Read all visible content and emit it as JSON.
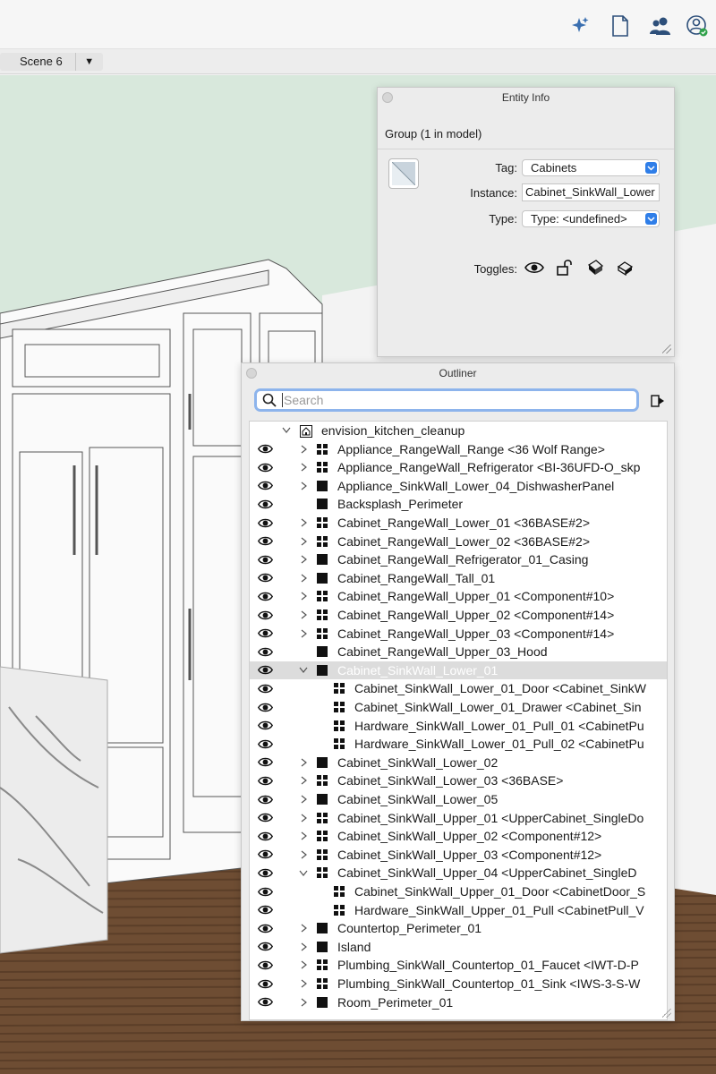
{
  "toolbar": {
    "icons": [
      "sparkle-icon",
      "document-icon",
      "users-icon",
      "account-icon"
    ]
  },
  "scenes": {
    "tabs": [
      "Scene 6"
    ],
    "menu_glyph": "▼"
  },
  "colors": {
    "accent": "#2f7ee8",
    "sparkle": "#3a6fb0",
    "viewport_wall": "#d8e8dc",
    "viewport_floor": "#6e4d33"
  },
  "entity_info": {
    "title": "Entity Info",
    "selection": "Group (1 in model)",
    "tag_label": "Tag:",
    "tag_value": "Cabinets",
    "instance_label": "Instance:",
    "instance_value": "Cabinet_SinkWall_Lower",
    "type_label": "Type:",
    "type_value": "Type: <undefined>",
    "toggles_label": "Toggles:",
    "toggle_icons": [
      "eye-icon",
      "unlock-icon",
      "cast-shadows-icon",
      "receive-shadows-icon"
    ]
  },
  "outliner": {
    "title": "Outliner",
    "search_placeholder": "Search",
    "root": "envision_kitchen_cleanup",
    "rows": [
      {
        "label": "Appliance_RangeWall_Range <36 Wolf Range>",
        "kind": "comp",
        "depth": 0,
        "expand": "collapsed"
      },
      {
        "label": "Appliance_RangeWall_Refrigerator <BI-36UFD-O_skp",
        "kind": "comp",
        "depth": 0,
        "expand": "collapsed"
      },
      {
        "label": "Appliance_SinkWall_Lower_04_DishwasherPanel",
        "kind": "group",
        "depth": 0,
        "expand": "collapsed"
      },
      {
        "label": "Backsplash_Perimeter",
        "kind": "group",
        "depth": 0,
        "expand": "none"
      },
      {
        "label": "Cabinet_RangeWall_Lower_01 <36BASE#2>",
        "kind": "comp",
        "depth": 0,
        "expand": "collapsed"
      },
      {
        "label": "Cabinet_RangeWall_Lower_02 <36BASE#2>",
        "kind": "comp",
        "depth": 0,
        "expand": "collapsed"
      },
      {
        "label": "Cabinet_RangeWall_Refrigerator_01_Casing",
        "kind": "group",
        "depth": 0,
        "expand": "collapsed"
      },
      {
        "label": "Cabinet_RangeWall_Tall_01",
        "kind": "group",
        "depth": 0,
        "expand": "collapsed"
      },
      {
        "label": "Cabinet_RangeWall_Upper_01 <Component#10>",
        "kind": "comp",
        "depth": 0,
        "expand": "collapsed"
      },
      {
        "label": "Cabinet_RangeWall_Upper_02 <Component#14>",
        "kind": "comp",
        "depth": 0,
        "expand": "collapsed"
      },
      {
        "label": "Cabinet_RangeWall_Upper_03 <Component#14>",
        "kind": "comp",
        "depth": 0,
        "expand": "collapsed"
      },
      {
        "label": "Cabinet_RangeWall_Upper_03_Hood",
        "kind": "group",
        "depth": 0,
        "expand": "none"
      },
      {
        "label": "Cabinet_SinkWall_Lower_01",
        "kind": "group",
        "depth": 0,
        "expand": "expanded",
        "selected": true
      },
      {
        "label": "Cabinet_SinkWall_Lower_01_Door <Cabinet_SinkW",
        "kind": "comp",
        "depth": 1,
        "expand": "none"
      },
      {
        "label": "Cabinet_SinkWall_Lower_01_Drawer <Cabinet_Sin",
        "kind": "comp",
        "depth": 1,
        "expand": "none"
      },
      {
        "label": "Hardware_SinkWall_Lower_01_Pull_01 <CabinetPu",
        "kind": "comp",
        "depth": 1,
        "expand": "none"
      },
      {
        "label": "Hardware_SinkWall_Lower_01_Pull_02 <CabinetPu",
        "kind": "comp",
        "depth": 1,
        "expand": "none"
      },
      {
        "label": "Cabinet_SinkWall_Lower_02",
        "kind": "group",
        "depth": 0,
        "expand": "collapsed"
      },
      {
        "label": "Cabinet_SinkWall_Lower_03 <36BASE>",
        "kind": "comp",
        "depth": 0,
        "expand": "collapsed"
      },
      {
        "label": "Cabinet_SinkWall_Lower_05",
        "kind": "group",
        "depth": 0,
        "expand": "collapsed"
      },
      {
        "label": "Cabinet_SinkWall_Upper_01 <UpperCabinet_SingleDo",
        "kind": "comp",
        "depth": 0,
        "expand": "collapsed"
      },
      {
        "label": "Cabinet_SinkWall_Upper_02 <Component#12>",
        "kind": "comp",
        "depth": 0,
        "expand": "collapsed"
      },
      {
        "label": "Cabinet_SinkWall_Upper_03 <Component#12>",
        "kind": "comp",
        "depth": 0,
        "expand": "collapsed"
      },
      {
        "label": "Cabinet_SinkWall_Upper_04 <UpperCabinet_SingleD",
        "kind": "comp",
        "depth": 0,
        "expand": "expanded"
      },
      {
        "label": "Cabinet_SinkWall_Upper_01_Door <CabinetDoor_S",
        "kind": "comp",
        "depth": 1,
        "expand": "none"
      },
      {
        "label": "Hardware_SinkWall_Upper_01_Pull <CabinetPull_V",
        "kind": "comp",
        "depth": 1,
        "expand": "none"
      },
      {
        "label": "Countertop_Perimeter_01",
        "kind": "group",
        "depth": 0,
        "expand": "collapsed"
      },
      {
        "label": "Island",
        "kind": "group",
        "depth": 0,
        "expand": "collapsed"
      },
      {
        "label": "Plumbing_SinkWall_Countertop_01_Faucet <IWT-D-P",
        "kind": "comp",
        "depth": 0,
        "expand": "collapsed"
      },
      {
        "label": "Plumbing_SinkWall_Countertop_01_Sink <IWS-3-S-W",
        "kind": "comp",
        "depth": 0,
        "expand": "collapsed"
      },
      {
        "label": "Room_Perimeter_01",
        "kind": "group",
        "depth": 0,
        "expand": "collapsed"
      }
    ]
  }
}
